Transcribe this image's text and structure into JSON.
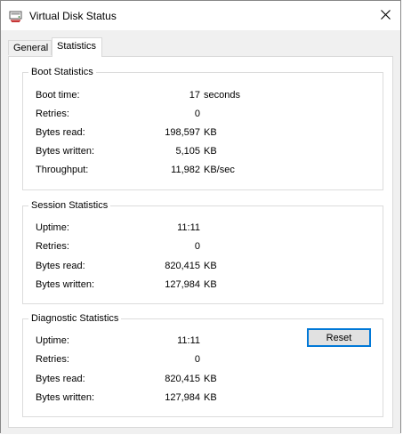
{
  "window": {
    "title": "Virtual Disk Status",
    "icon": "virtual-disk-icon",
    "close_icon": "close-icon"
  },
  "tabs": [
    {
      "label": "General",
      "active": false
    },
    {
      "label": "Statistics",
      "active": true
    }
  ],
  "boot": {
    "title": "Boot Statistics",
    "rows": [
      {
        "label": "Boot time:",
        "value": "17",
        "unit": "seconds"
      },
      {
        "label": "Retries:",
        "value": "0",
        "unit": ""
      },
      {
        "label": "Bytes read:",
        "value": "198,597",
        "unit": "KB"
      },
      {
        "label": "Bytes written:",
        "value": "5,105",
        "unit": "KB"
      },
      {
        "label": "Throughput:",
        "value": "11,982",
        "unit": "KB/sec"
      }
    ]
  },
  "session": {
    "title": "Session Statistics",
    "rows": [
      {
        "label": "Uptime:",
        "value": "11:11",
        "unit": ""
      },
      {
        "label": "Retries:",
        "value": "0",
        "unit": ""
      },
      {
        "label": "Bytes read:",
        "value": "820,415",
        "unit": "KB"
      },
      {
        "label": "Bytes written:",
        "value": "127,984",
        "unit": "KB"
      }
    ]
  },
  "diagnostic": {
    "title": "Diagnostic Statistics",
    "reset_label": "Reset",
    "rows": [
      {
        "label": "Uptime:",
        "value": "11:11",
        "unit": ""
      },
      {
        "label": "Retries:",
        "value": "0",
        "unit": ""
      },
      {
        "label": "Bytes read:",
        "value": "820,415",
        "unit": "KB"
      },
      {
        "label": "Bytes written:",
        "value": "127,984",
        "unit": "KB"
      }
    ]
  },
  "colors": {
    "focus_border": "#0078d7",
    "button_face": "#e1e1e1",
    "dialog_bg": "#f0f0f0",
    "group_border": "#dcdcdc"
  }
}
